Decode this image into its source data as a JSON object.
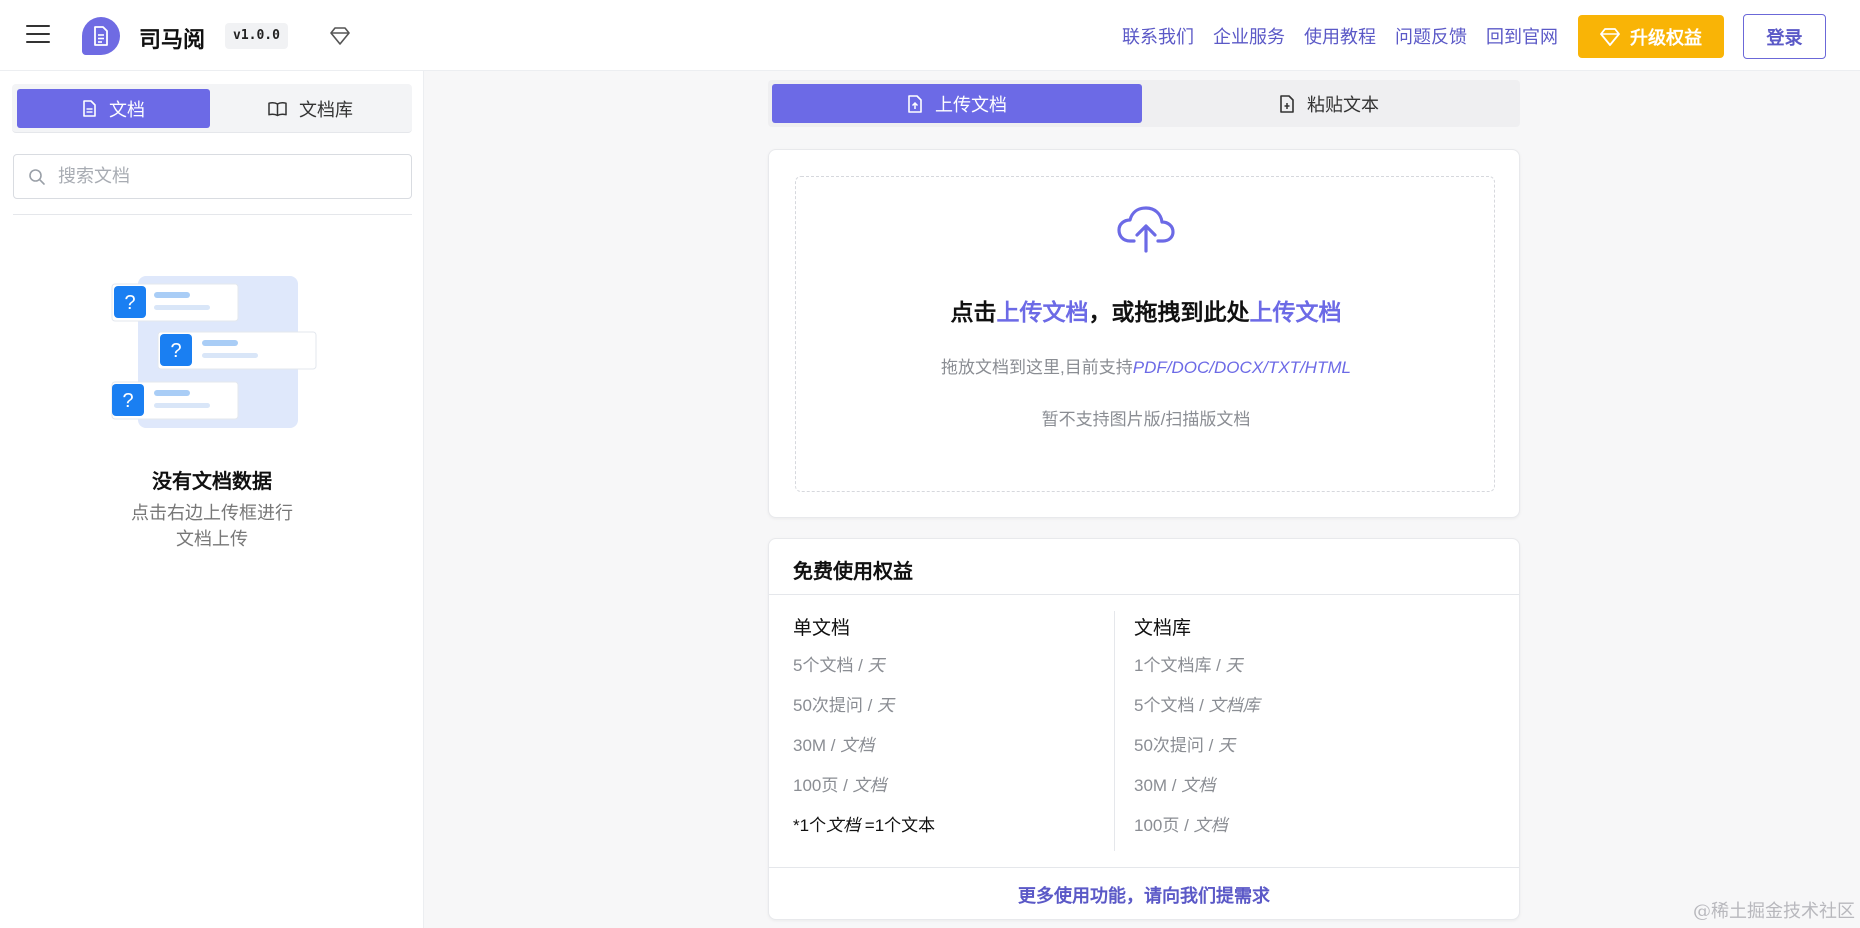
{
  "header": {
    "app_title": "司马阅",
    "version": "v1.0.0",
    "nav": [
      "联系我们",
      "企业服务",
      "使用教程",
      "问题反馈",
      "回到官网"
    ],
    "upgrade_label": "升级权益",
    "login_label": "登录",
    "icons": [
      "menu-icon",
      "logo-icon",
      "gem-icon"
    ]
  },
  "sidebar": {
    "tabs": [
      {
        "label": "文档",
        "icon": "document-icon",
        "active": true
      },
      {
        "label": "文档库",
        "icon": "book-icon",
        "active": false
      }
    ],
    "search": {
      "placeholder": "搜索文档",
      "value": ""
    },
    "empty": {
      "title": "没有文档数据",
      "desc": "点击右边上传框进行文档上传"
    }
  },
  "main": {
    "tabs": [
      {
        "label": "上传文档",
        "icon": "file-upload-icon",
        "active": true
      },
      {
        "label": "粘贴文本",
        "icon": "file-paste-icon",
        "active": false
      }
    ],
    "upload": {
      "headline_pre": "点击",
      "headline_link1": "上传文档",
      "headline_mid": "，或拖拽到此处",
      "headline_link2": "上传文档",
      "support_pre": "拖放文档到这里,目前支持",
      "support_formats": "PDF/DOC/DOCX/TXT/HTML",
      "scan_note": "暂不支持图片版/扫描版文档"
    },
    "benefits": {
      "title": "免费使用权益",
      "left_column": {
        "header": "单文档",
        "items": [
          {
            "a": "5个文档 / ",
            "b": "天"
          },
          {
            "a": "50次提问 / ",
            "b": "天"
          },
          {
            "a": "30M / ",
            "b": "文档"
          },
          {
            "a": "100页 / ",
            "b": "文档"
          }
        ],
        "note": {
          "a": "*1个",
          "b": "文档",
          "c": " =1个文本"
        }
      },
      "right_column": {
        "header": "文档库",
        "items": [
          {
            "a": "1个文档库 / ",
            "b": "天"
          },
          {
            "a": "5个文档 / ",
            "b": "文档库"
          },
          {
            "a": "50次提问 / ",
            "b": "天"
          },
          {
            "a": "30M / ",
            "b": "文档"
          },
          {
            "a": "100页 / ",
            "b": "文档"
          }
        ]
      },
      "footer_link": "更多使用功能，请向我们提需求"
    }
  },
  "watermark": "@稀土掘金技术社区",
  "colors": {
    "accent": "#6c6ae6",
    "link": "#5b59c7",
    "upgrade": "#f9b406"
  }
}
